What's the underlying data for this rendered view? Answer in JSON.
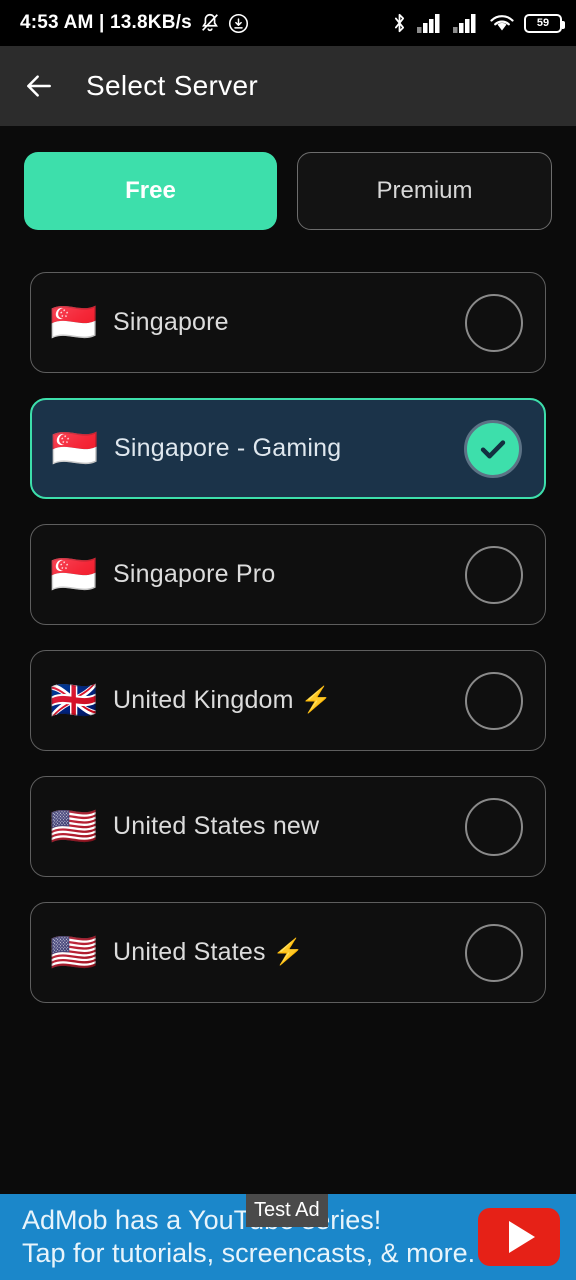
{
  "status_bar": {
    "clock": "4:53 AM | 13.8KB/s",
    "icons": [
      "bell-muted-icon",
      "screen-record-icon",
      "bluetooth-icon",
      "signal-sim1-icon",
      "signal-sim2-icon",
      "wifi-icon"
    ],
    "battery_level": "59"
  },
  "app_bar": {
    "back_icon": "back-arrow-icon",
    "title": "Select Server"
  },
  "tabs": [
    {
      "label": "Free",
      "active": true
    },
    {
      "label": "Premium",
      "active": false
    }
  ],
  "servers": [
    {
      "flag": "🇸🇬",
      "name": "Singapore",
      "selected": false
    },
    {
      "flag": "🇸🇬",
      "name": "Singapore - Gaming",
      "selected": true
    },
    {
      "flag": "🇸🇬",
      "name": "Singapore Pro",
      "selected": false
    },
    {
      "flag": "🇬🇧",
      "name": "United Kingdom ⚡",
      "selected": false
    },
    {
      "flag": "🇺🇸",
      "name": "United States new",
      "selected": false
    },
    {
      "flag": "🇺🇸",
      "name": "United States ⚡",
      "selected": false
    }
  ],
  "ad": {
    "badge": "Test Ad",
    "line1": "AdMob has a YouTube series!",
    "line2": "Tap for tutorials, screencasts, & more.",
    "logo": "youtube-play-icon"
  },
  "colors": {
    "accent": "#3ddfab",
    "selected_row_bg": "#1b3349",
    "app_bar_bg": "#2c2c2c",
    "page_bg": "#0b0b0b",
    "ad_bg": "#1b87ca",
    "youtube_red": "#e62117"
  }
}
